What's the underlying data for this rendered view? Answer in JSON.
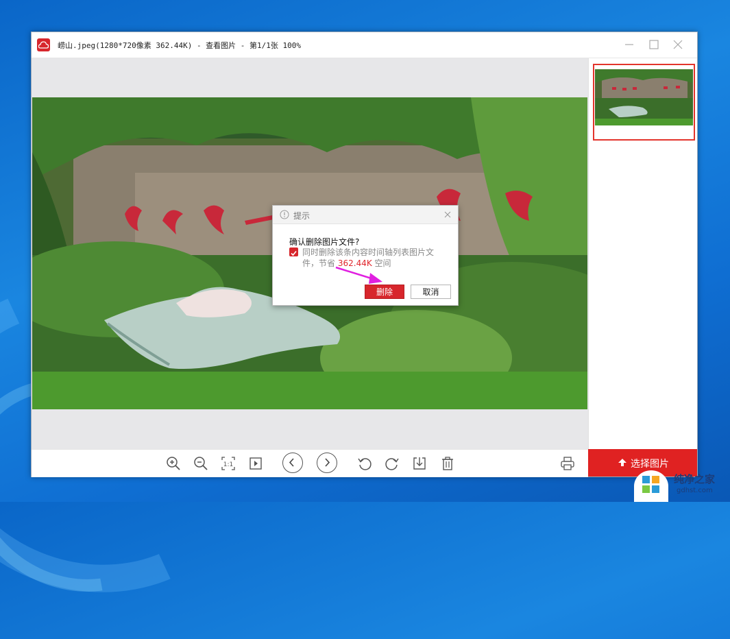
{
  "window": {
    "title": "崂山.jpeg(1280*720像素 362.44K) - 查看图片 - 第1/1张 100%"
  },
  "dialog": {
    "title": "提示",
    "question": "确认删除图片文件?",
    "note_prefix": "同时删除该条内容时间轴列表图片文件，节省",
    "note_size": "362.44K",
    "note_suffix": "空间",
    "checkbox_checked": true,
    "delete_label": "删除",
    "cancel_label": "取消"
  },
  "sidebar": {
    "select_label": "选择图片"
  },
  "toolbar": {
    "icons": [
      "zoom-in-icon",
      "zoom-out-icon",
      "actual-size-icon",
      "slideshow-icon",
      "prev-icon",
      "next-icon",
      "rotate-left-icon",
      "rotate-right-icon",
      "save-icon",
      "delete-icon",
      "print-icon"
    ]
  },
  "watermark": {
    "title": "纯净之家",
    "url": "gdhst.com"
  },
  "colors": {
    "accent": "#e02222",
    "desktop": "#1a86e0"
  }
}
